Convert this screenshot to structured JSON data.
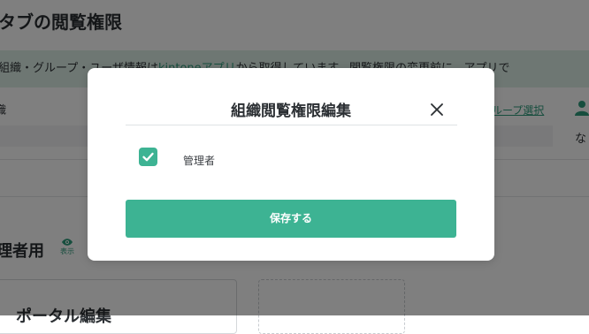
{
  "page": {
    "title": "タブの閲覧権限",
    "info": {
      "text_before": "組織・グループ・ユーザ情報は",
      "link": "kintoneアプリ",
      "text_after": "から取得しています。閲覧権限の変更前に、アプリで"
    },
    "org_label": "織",
    "group_select_link": "ループ選択",
    "none_text": "な",
    "section_title": "理者用",
    "view_badge_label": "表示",
    "card_title": "ポータル編集"
  },
  "modal": {
    "title": "組織閲覧権限編集",
    "checkbox": {
      "label": "管理者",
      "checked": true
    },
    "save_label": "保存する"
  },
  "colors": {
    "accent": "#3db393",
    "link": "#2e9c7c",
    "overlay": "rgba(0,0,0,0.5)"
  },
  "icons": {
    "close": "close-icon",
    "check": "check-icon",
    "user": "user-icon",
    "eye": "eye-icon"
  }
}
